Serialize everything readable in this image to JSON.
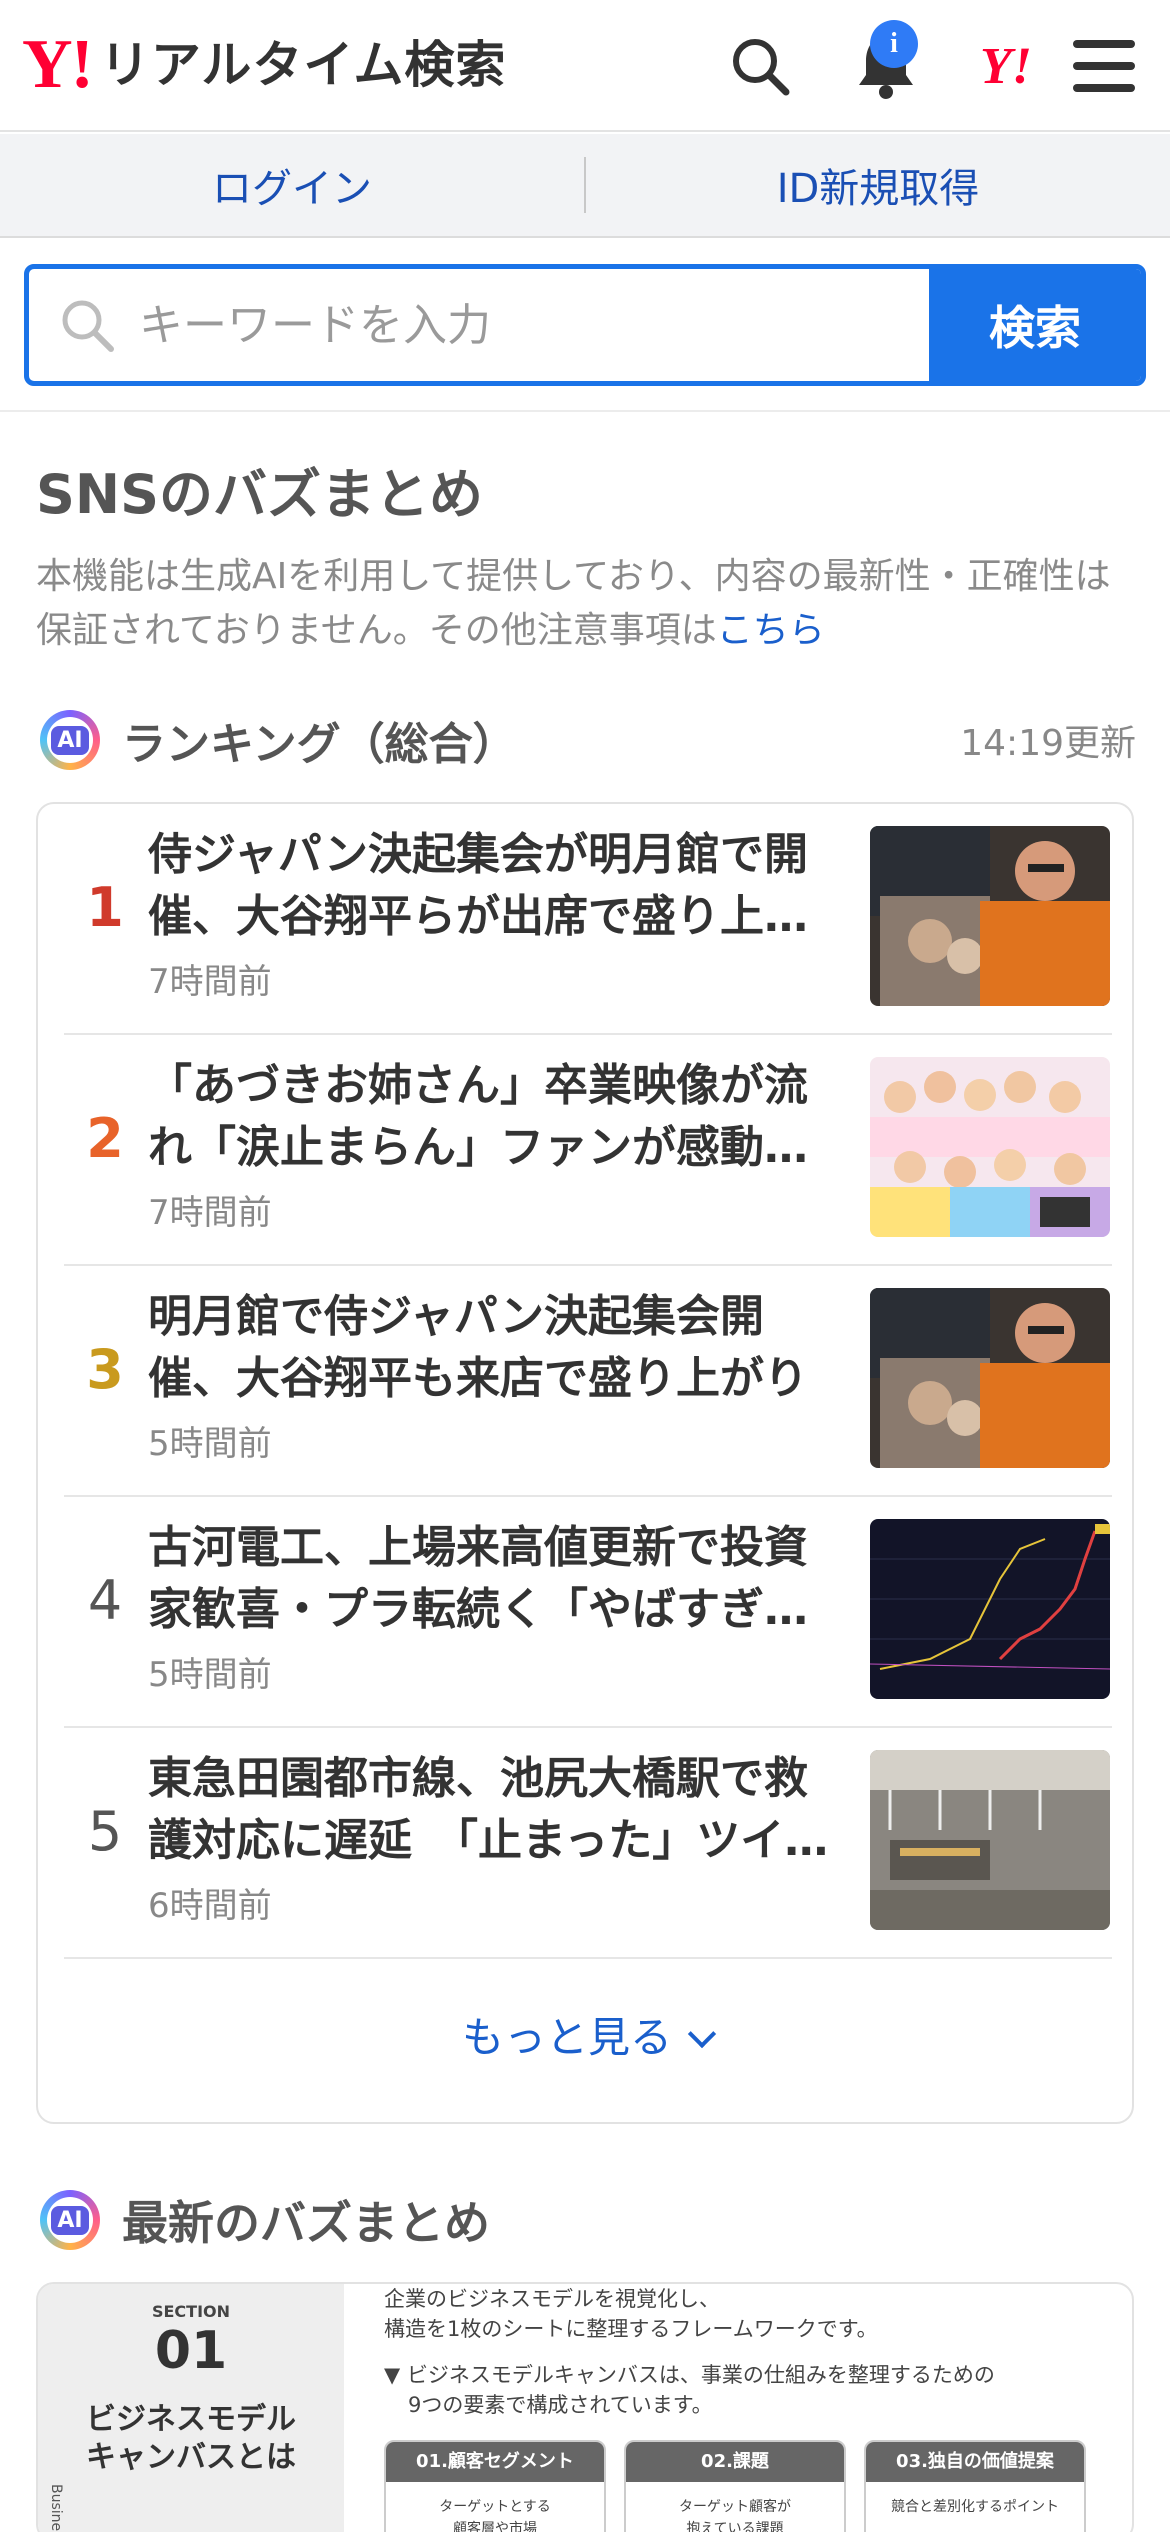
{
  "header": {
    "logo_mark": "Y!",
    "logo_text": "リアルタイム検索",
    "notification_badge": "i",
    "yjapan_logo": "Y!",
    "icons": [
      "search-icon",
      "bell-icon",
      "menu-icon"
    ]
  },
  "account": {
    "login": "ログイン",
    "signup": "ID新規取得"
  },
  "search": {
    "placeholder": "キーワードを入力",
    "button": "検索"
  },
  "sns": {
    "title": "SNSのバズまとめ",
    "notice": "本機能は生成AIを利用して提供しており、内容の最新性・正確性は保証されておりません。その他注意事項は",
    "notice_link": "こちら"
  },
  "ranking": {
    "ai_label": "AI",
    "title": "ランキング（総合）",
    "updated": "14:19更新",
    "items": [
      {
        "rank": "1",
        "title": "侍ジャパン決起集会が明月館で開催、大谷翔平らが出席で盛り上…",
        "time": "7時間前",
        "color": "#d03a2b"
      },
      {
        "rank": "2",
        "title": "「あづきお姉さん」卒業映像が流れ「涙止まらん」ファンが感動…",
        "time": "7時間前",
        "color": "#e8632a"
      },
      {
        "rank": "3",
        "title": "明月館で侍ジャパン決起集会開催、大谷翔平も来店で盛り上がり",
        "time": "5時間前",
        "color": "#c99a1e"
      },
      {
        "rank": "4",
        "title": "古河電工、上場来高値更新で投資家歓喜・プラ転続く「やばすぎ…",
        "time": "5時間前",
        "color": "#555555"
      },
      {
        "rank": "5",
        "title": "東急田園都市線、池尻大橋駅で救護対応に遅延　「止まった」ツイ…",
        "time": "6時間前",
        "color": "#555555"
      }
    ],
    "more": "もっと見る"
  },
  "latest": {
    "ai_label": "AI",
    "title": "最新のバズまとめ",
    "card": {
      "section_label": "SECTION",
      "section_num": "01",
      "heading_line1": "ビジネスモデル",
      "heading_line2": "キャンバスとは",
      "side_text": "Busine",
      "desc_line1": "企業のビジネスモデルを視覚化し、",
      "desc_line2": "構造を1枚のシートに整理するフレームワークです。",
      "note_line1": "▼ ビジネスモデルキャンバスは、事業の仕組みを整理するための",
      "note_line2": "9つの要素で構成されています。",
      "boxes": [
        {
          "head": "01.顧客セグメント",
          "body1": "ターゲットとする",
          "body2": "顧客層や市場"
        },
        {
          "head": "02.課題",
          "body1": "ターゲット顧客が",
          "body2": "抱えている課題"
        },
        {
          "head": "03.独自の価値提案",
          "body1": "競合と差別化するポイント",
          "body2": ""
        }
      ]
    }
  }
}
